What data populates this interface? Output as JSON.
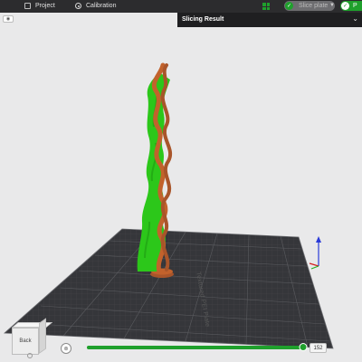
{
  "topbar": {
    "tabs": [
      {
        "label": "Project",
        "icon": "project-icon"
      },
      {
        "label": "Calibration",
        "icon": "calibration-icon"
      }
    ],
    "slice_button_label": "Slice plate",
    "print_button_label": "P"
  },
  "slicing_result": {
    "title": "Slicing Result"
  },
  "scene": {
    "plate_label": "Textured PEI Plate",
    "model_colors": {
      "support": "#2cc71a",
      "model": "#c2622c"
    }
  },
  "viewcube": {
    "face_label": "Back"
  },
  "layer_slider": {
    "value": "152",
    "fraction": 1.0
  },
  "colors": {
    "accent": "#1fa02c",
    "topbar_bg": "#2c2c2e",
    "panel_bg": "#1f1f21",
    "plate": "#3a3b3d"
  }
}
